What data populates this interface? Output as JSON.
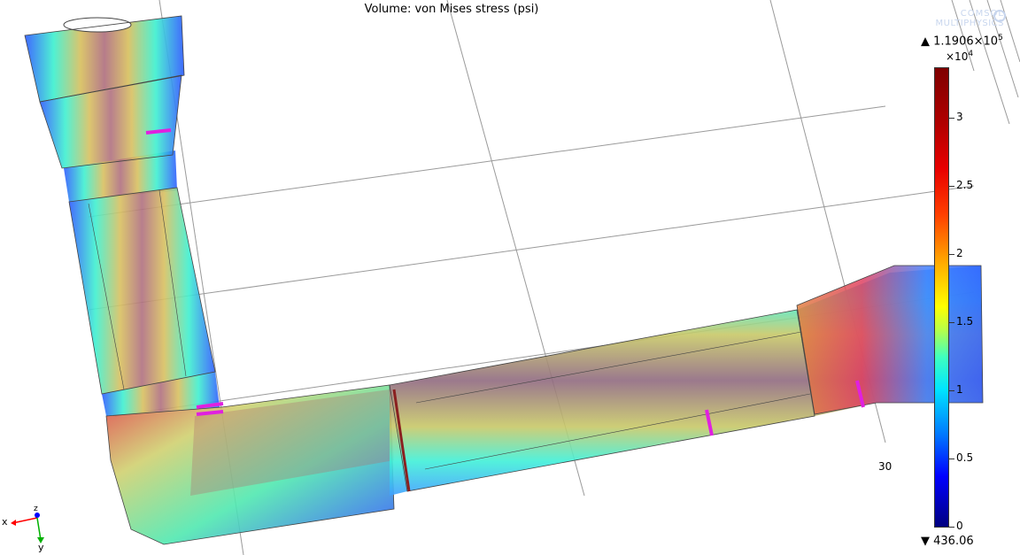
{
  "plot": {
    "title": "Volume: von Mises stress (psi)",
    "axis_tick_label": "30"
  },
  "colorbar": {
    "max_label": "▲ 1.1906×10",
    "max_exponent": "5",
    "scale_label": "×10",
    "scale_exponent": "4",
    "min_label": "▼ 436.06",
    "ticks": [
      "3",
      "2.5",
      "2",
      "1.5",
      "1",
      "0.5",
      "0"
    ],
    "colormap": "Rainbow"
  },
  "logo": {
    "line1": "COMSOL",
    "line2": "MULTIPHYSICS"
  },
  "triad": {
    "x_label": "x",
    "y_label": "y",
    "z_label": "z"
  },
  "colors": {
    "x_axis": "#ff0000",
    "y_axis": "#00b000",
    "z_axis": "#0000ff",
    "logo": "#c8d6ee"
  }
}
